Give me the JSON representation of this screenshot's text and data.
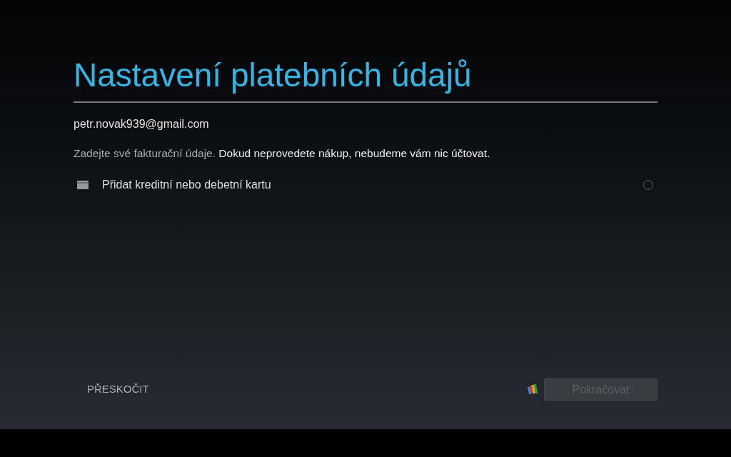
{
  "title": "Nastavení platebních údajů",
  "account": "petr.novak939@gmail.com",
  "intro": {
    "note": "Zadejte své fakturační údaje.",
    "emphasis": "Dokud neprovedete nákup, nebudeme vám nic účtovat."
  },
  "payment_options": [
    {
      "label": "Přidat kreditní nebo debetní kartu",
      "selected": false
    }
  ],
  "skip_button": {
    "label": "PŘESKOČIT"
  },
  "continue_button": {
    "label": "Pokračovat",
    "disabled": true
  }
}
